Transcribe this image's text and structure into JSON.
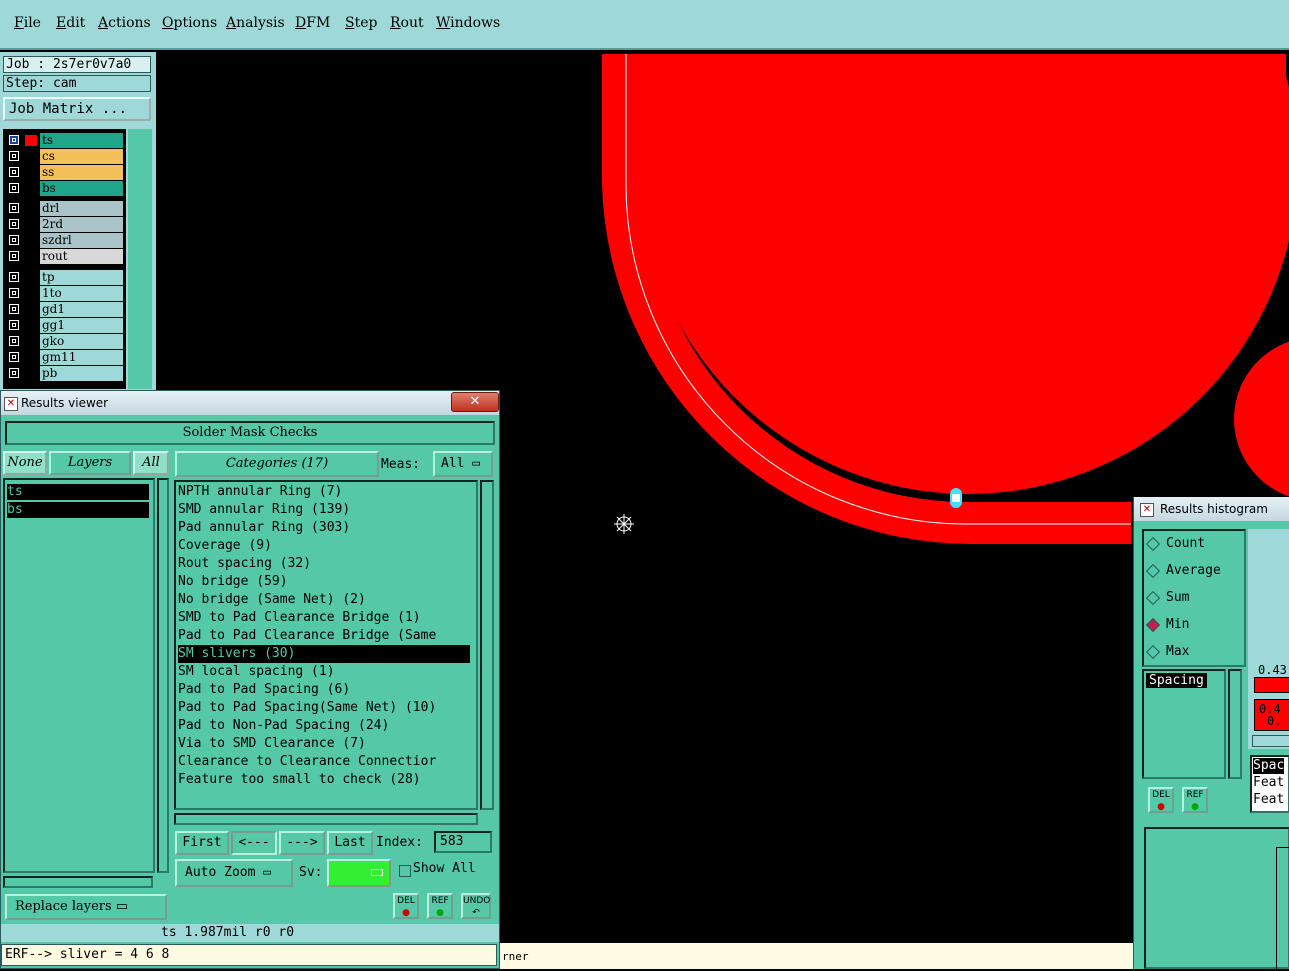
{
  "menu": [
    "File",
    "Edit",
    "Actions",
    "Options",
    "Analysis",
    "DFM",
    "Step",
    "Rout",
    "Windows"
  ],
  "job": {
    "label": "Job : 2s7er0v7a0",
    "step": "Step: cam",
    "matrix_button": "Job Matrix ..."
  },
  "layers": [
    {
      "name": "ts",
      "color": "#1fa58a",
      "flag": "▫"
    },
    {
      "name": "cs",
      "color": "#f4c05a",
      "flag": "⬩"
    },
    {
      "name": "ss",
      "color": "#f4c05a",
      "flag": "⬩"
    },
    {
      "name": "bs",
      "color": "#1fa58a",
      "flag": ""
    },
    {
      "name": "drl",
      "color": "#a8c4c8",
      "flag": ""
    },
    {
      "name": "2rd",
      "color": "#a8c4c8",
      "flag": ""
    },
    {
      "name": "szdrl",
      "color": "#a8c4c8",
      "flag": ""
    },
    {
      "name": "rout",
      "color": "#d8d8d8",
      "flag": ""
    },
    {
      "name": "tp",
      "color": "#9ed8d8",
      "flag": ""
    },
    {
      "name": "1to",
      "color": "#9ed8d8",
      "flag": "⬩"
    },
    {
      "name": "gd1",
      "color": "#9ed8d8",
      "flag": "⬩"
    },
    {
      "name": "gg1",
      "color": "#9ed8d8",
      "flag": ""
    },
    {
      "name": "gko",
      "color": "#9ed8d8",
      "flag": "⬩"
    },
    {
      "name": "gm11",
      "color": "#9ed8d8",
      "flag": "⬩"
    },
    {
      "name": "pb",
      "color": "#9ed8d8",
      "flag": ""
    }
  ],
  "results_viewer": {
    "title": "Results viewer",
    "close": "✕",
    "header": "Solder Mask Checks",
    "none_btn": "None",
    "layers_btn": "Layers",
    "all_btn": "All",
    "categories_btn": "Categories (17)",
    "meas_label": "Meas:",
    "meas_value": "All",
    "selected_layers": [
      "ts",
      "bs"
    ],
    "categories": [
      "NPTH annular Ring (7)",
      "SMD annular Ring (139)",
      "Pad annular Ring (303)",
      "Coverage (9)",
      "Rout spacing (32)",
      "No bridge (59)",
      "No bridge (Same Net) (2)",
      "SMD to Pad Clearance Bridge (1)",
      "Pad to Pad Clearance Bridge (Same",
      "SM slivers (30)",
      "SM local spacing (1)",
      "Pad to Pad Spacing (6)",
      "Pad to Pad Spacing(Same Net) (10)",
      "Pad to Non-Pad Spacing (24)",
      "Via to SMD Clearance (7)",
      "Clearance to Clearance Connectior",
      "Feature too small to check (28)"
    ],
    "selected_index": 9,
    "first": "First",
    "prev": "<---",
    "next": "--->",
    "last": "Last",
    "index_label": "Index:",
    "index_value": "583",
    "auto_zoom": "Auto Zoom",
    "sv_label": "Sv:",
    "show_all": "Show All",
    "replace_layers": "Replace layers",
    "del": "DEL",
    "ref": "REF",
    "undo": "UNDO",
    "info": "ts 1.987mil  r0  r0",
    "erf": "ERF--> sliver = 4 6 8"
  },
  "status_text": "rner",
  "histogram": {
    "title": "Results histogram",
    "options": [
      "Count",
      "Average",
      "Sum",
      "Min",
      "Max"
    ],
    "selected": "Min",
    "list": [
      "Spacing"
    ],
    "val1": "0.43",
    "val2": "0.4",
    "val3": "0.",
    "del": "DEL",
    "ref": "REF",
    "rows": [
      "Spac",
      "Feat",
      "Feat"
    ]
  },
  "colors": {
    "copper": "#ff0000",
    "panel": "#55c8a8",
    "menu": "#9ed8d8"
  }
}
